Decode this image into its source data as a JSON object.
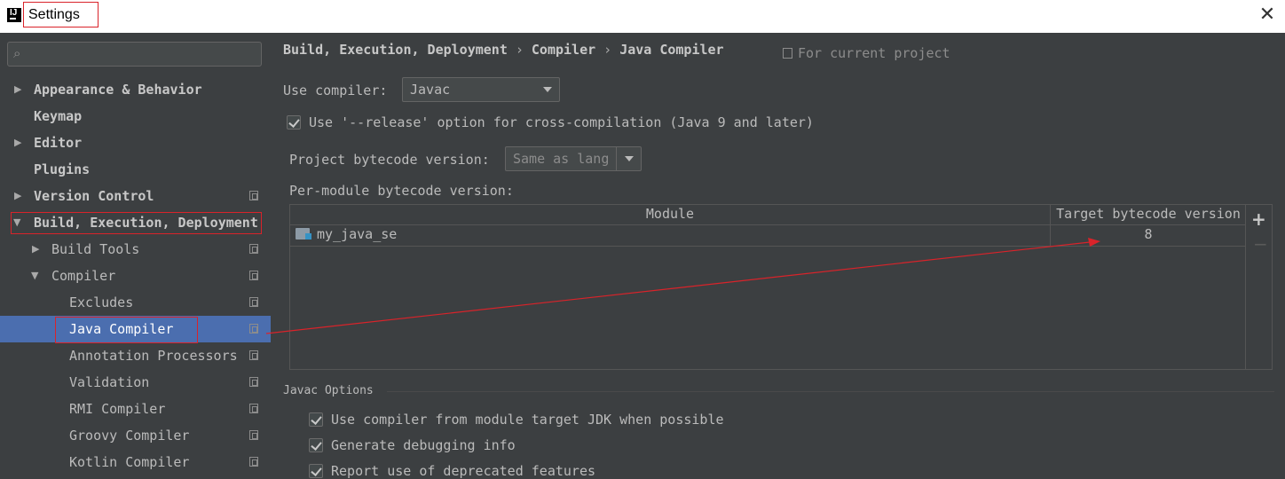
{
  "window": {
    "title": "Settings",
    "close_glyph": "✕"
  },
  "sidebar": {
    "search": {
      "value": "",
      "placeholder": ""
    },
    "items": [
      {
        "label": "Appearance & Behavior"
      },
      {
        "label": "Keymap"
      },
      {
        "label": "Editor"
      },
      {
        "label": "Plugins"
      },
      {
        "label": "Version Control"
      },
      {
        "label": "Build, Execution, Deployment"
      },
      {
        "label": "Build Tools"
      },
      {
        "label": "Compiler"
      },
      {
        "label": "Excludes"
      },
      {
        "label": "Java Compiler"
      },
      {
        "label": "Annotation Processors"
      },
      {
        "label": "Validation"
      },
      {
        "label": "RMI Compiler"
      },
      {
        "label": "Groovy Compiler"
      },
      {
        "label": "Kotlin Compiler"
      }
    ]
  },
  "breadcrumb": {
    "part1": "Build, Execution, Deployment",
    "part2": "Compiler",
    "part3": "Java Compiler",
    "separator": "›"
  },
  "scope_label": "For current project",
  "compiler": {
    "use_compiler_label": "Use compiler:",
    "use_compiler_value": "Javac",
    "release_option_label": "Use '--release' option for cross-compilation (Java 9 and later)",
    "project_bytecode_label": "Project bytecode version:",
    "project_bytecode_value": "Same as lang",
    "per_module_label": "Per-module bytecode version:"
  },
  "module_table": {
    "headers": {
      "module": "Module",
      "target": "Target bytecode version"
    },
    "rows": [
      {
        "module": "my_java_se",
        "target": "8"
      }
    ],
    "add_label": "+",
    "remove_label": "−"
  },
  "javac_options": {
    "title": "Javac Options",
    "options": [
      "Use compiler from module target JDK when possible",
      "Generate debugging info",
      "Report use of deprecated features"
    ]
  },
  "colors": {
    "background": "#3c3f41",
    "selection": "#4b6eaf",
    "annotation_red": "#d9232a"
  }
}
